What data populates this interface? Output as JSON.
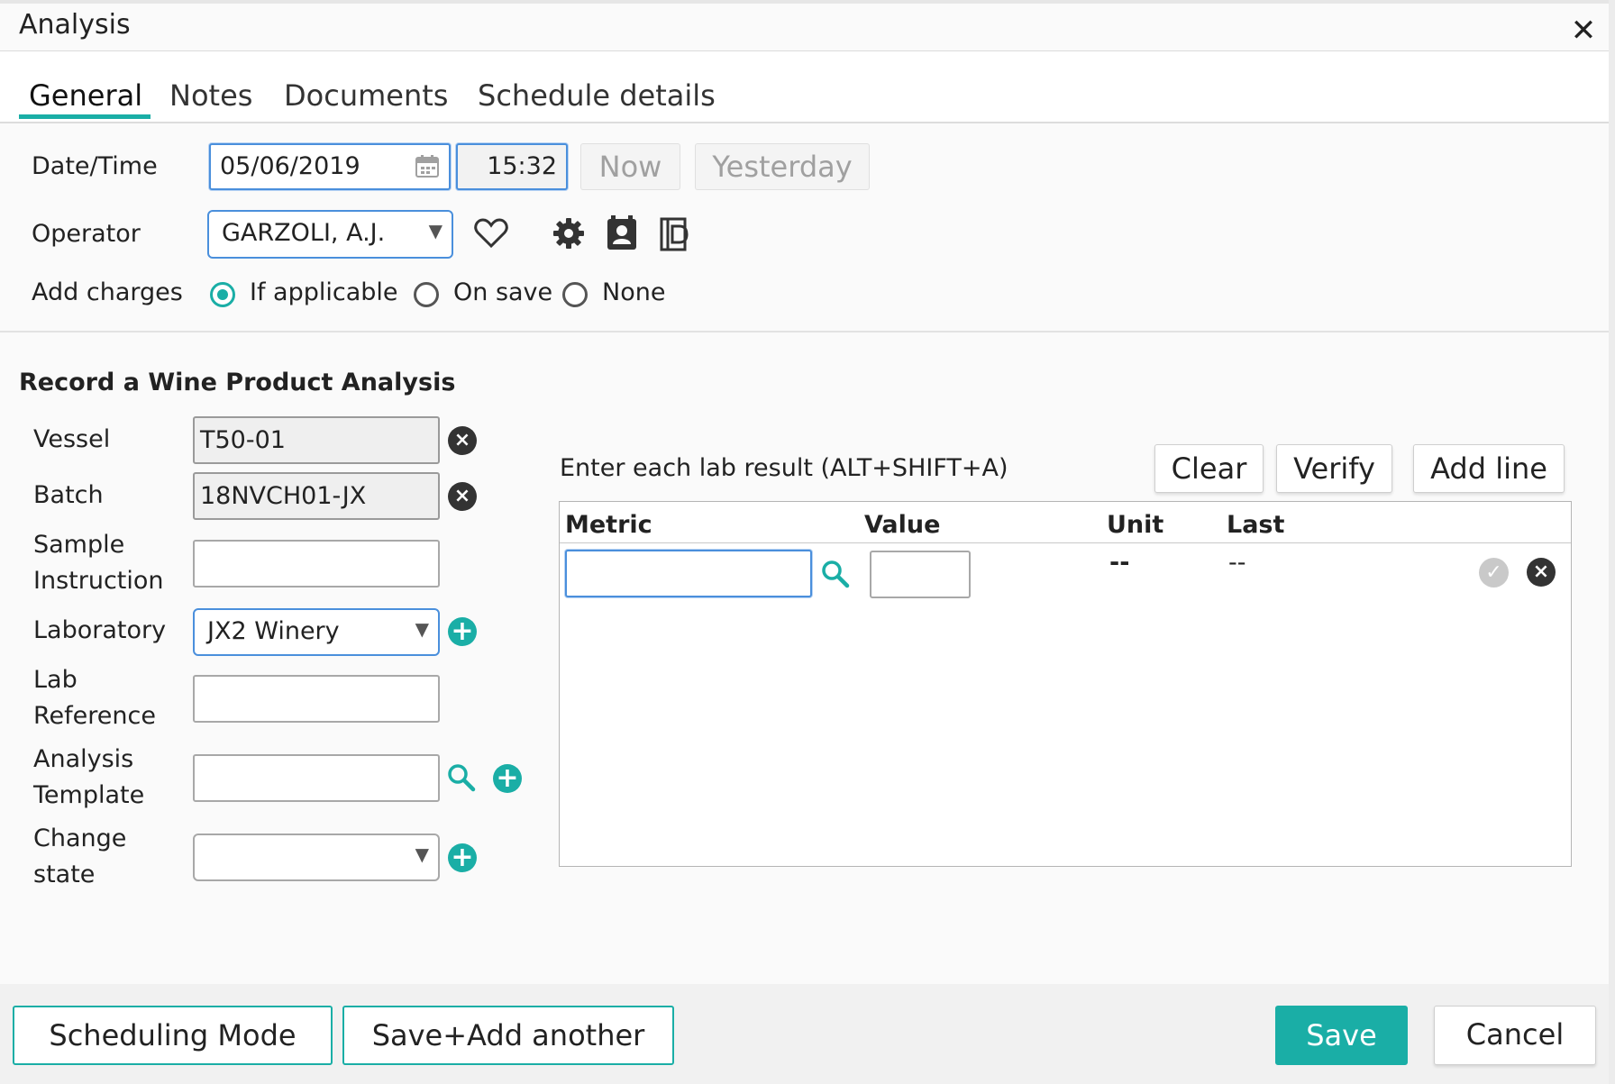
{
  "dialog": {
    "title": "Analysis",
    "close_icon": "close-icon"
  },
  "tabs": [
    {
      "label": "General",
      "active": true
    },
    {
      "label": "Notes",
      "active": false
    },
    {
      "label": "Documents",
      "active": false
    },
    {
      "label": "Schedule details",
      "active": false
    }
  ],
  "general": {
    "datetime_label": "Date/Time",
    "date_value": "05/06/2019",
    "time_value": "15:32",
    "now_label": "Now",
    "yesterday_label": "Yesterday",
    "operator_label": "Operator",
    "operator_value": "GARZOLI, A.J.",
    "add_charges_label": "Add charges",
    "charge_options": [
      {
        "label": "If applicable",
        "selected": true
      },
      {
        "label": "On save",
        "selected": false
      },
      {
        "label": "None",
        "selected": false
      }
    ]
  },
  "form": {
    "section_title": "Record a Wine Product Analysis",
    "vessel_label": "Vessel",
    "vessel_value": "T50-01",
    "batch_label": "Batch",
    "batch_value": "18NVCH01-JX",
    "sample_instruction_label_1": "Sample",
    "sample_instruction_label_2": "Instruction",
    "sample_instruction_value": "",
    "laboratory_label": "Laboratory",
    "laboratory_value": "JX2 Winery",
    "lab_reference_label_1": "Lab",
    "lab_reference_label_2": "Reference",
    "lab_reference_value": "",
    "analysis_template_label_1": "Analysis",
    "analysis_template_label_2": "Template",
    "analysis_template_value": "",
    "change_state_label_1": "Change",
    "change_state_label_2": "state",
    "change_state_value": ""
  },
  "lab_results": {
    "instruction": "Enter each lab result (ALT+SHIFT+A)",
    "clear_label": "Clear",
    "verify_label": "Verify",
    "add_line_label": "Add line",
    "columns": [
      "Metric",
      "Value",
      "Unit",
      "Last"
    ],
    "rows": [
      {
        "metric": "",
        "value": "",
        "unit": "--",
        "last": "--"
      }
    ]
  },
  "footer": {
    "scheduling_mode_label": "Scheduling Mode",
    "save_add_another_label": "Save+Add another",
    "save_label": "Save",
    "cancel_label": "Cancel"
  },
  "colors": {
    "accent": "#1aaea6",
    "focus": "#4a8fdc"
  }
}
